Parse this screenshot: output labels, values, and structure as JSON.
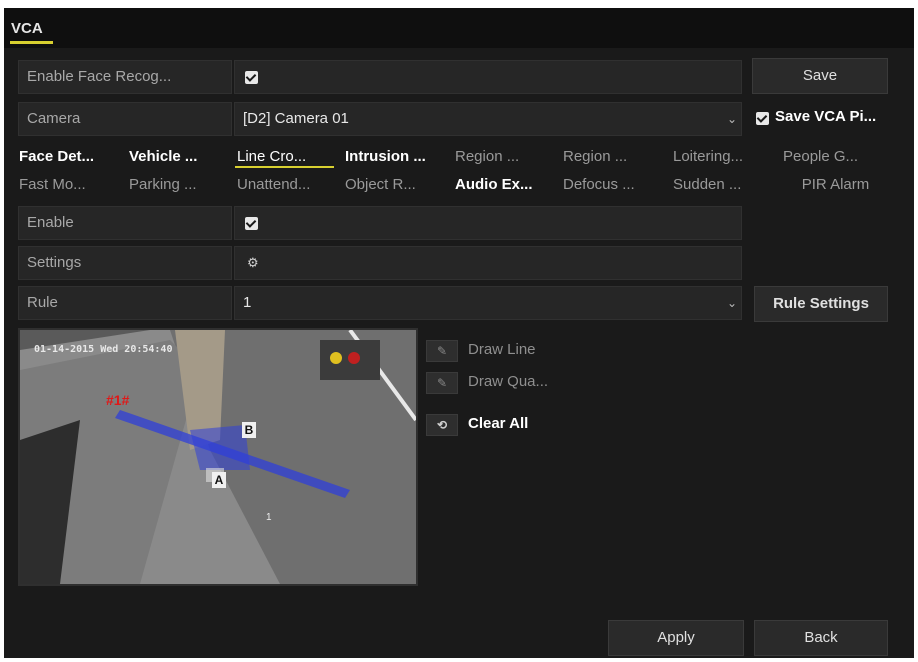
{
  "window": {
    "title": "VCA"
  },
  "face_recognition": {
    "label": "Enable Face Recog...",
    "checked": true
  },
  "save_button": "Save",
  "camera": {
    "label": "Camera",
    "value": "[D2] Camera 01",
    "save_pic_label": "Save VCA Pi..."
  },
  "tabs_row1": [
    "Face Det...",
    "Vehicle ...",
    "Line Cro...",
    "Intrusion ...",
    "Region ...",
    "Region ...",
    "Loitering...",
    "People G..."
  ],
  "tabs_row2": [
    "Fast Mo...",
    "Parking ...",
    "Unattend...",
    "Object R...",
    "Audio Ex...",
    "Defocus ...",
    "Sudden ...",
    "PIR Alarm"
  ],
  "enable": {
    "label": "Enable",
    "checked": true
  },
  "settings": {
    "label": "Settings",
    "icon": "gear-icon"
  },
  "rule": {
    "label": "Rule",
    "value": "1",
    "button": "Rule Settings"
  },
  "preview": {
    "osd_timestamp": "01-14-2015 Wed 20:54:40",
    "line_label": "#1#",
    "marker_a": "A",
    "marker_b": "B",
    "small_text": "1"
  },
  "tools": {
    "draw_line": "Draw Line",
    "draw_quad": "Draw Qua...",
    "clear_all": "Clear All"
  },
  "footer": {
    "apply": "Apply",
    "back": "Back"
  }
}
